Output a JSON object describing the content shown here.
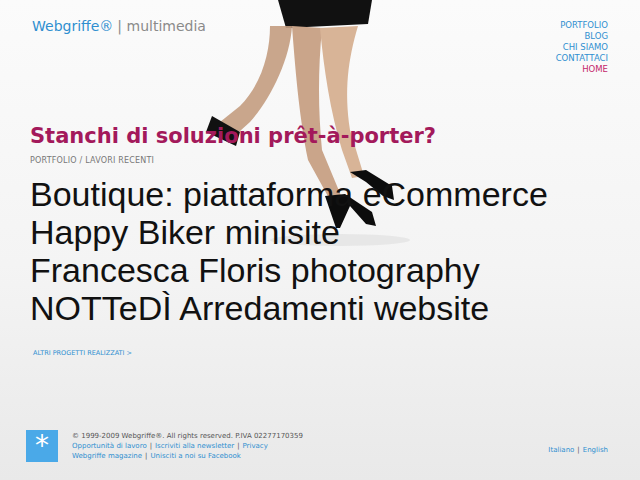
{
  "logo": {
    "brand": "Webgriffe®",
    "sub": "| multimedia"
  },
  "nav": [
    {
      "label": "PORTFOLIO",
      "selected": false
    },
    {
      "label": "BLOG",
      "selected": false
    },
    {
      "label": "CHI SIAMO",
      "selected": false
    },
    {
      "label": "CONTATTACI",
      "selected": false
    },
    {
      "label": "HOME",
      "selected": true
    }
  ],
  "headline": "Stanchi di soluzioni prêt-à-porter?",
  "breadcrumb": "PORTFOLIO / LAVORI RECENTI",
  "projects": [
    "Boutique: piattaforma eCommerce",
    "Happy Biker minisite",
    "Francesca Floris photography",
    "NOTTeDÌ Arredamenti website"
  ],
  "more_link": "ALTRI PROGETTI REALIZZATI >",
  "footer": {
    "icon": "*",
    "copyright": "© 1999-2009 Webgriffe®. All rights reserved. P.IVA 02277170359",
    "separator": "|",
    "links": [
      [
        "Opportunità di lavoro",
        "Iscriviti alla newsletter",
        "Privacy"
      ],
      [
        "Webgriffe magazine",
        "Unisciti a noi su Facebook"
      ]
    ]
  },
  "languages": [
    "Italiano",
    "English"
  ]
}
